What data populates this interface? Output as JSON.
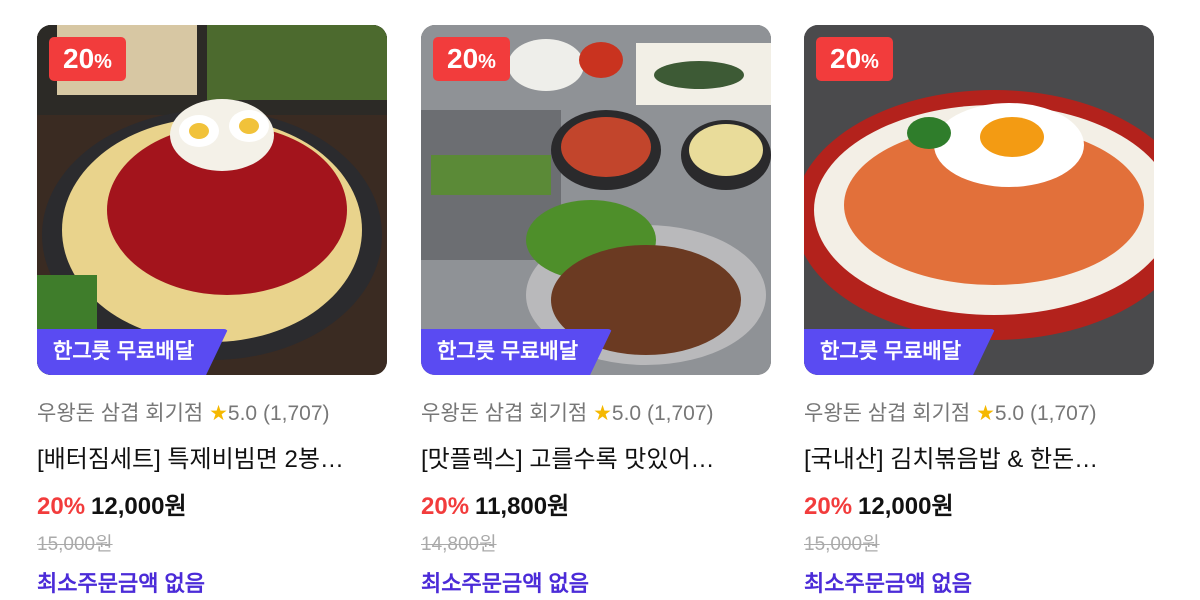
{
  "products": [
    {
      "discount_badge": "20",
      "discount_badge_unit": "%",
      "delivery_tag": "한그릇 무료배달",
      "store": "우왕돈 삼겹 회기점",
      "star": "★",
      "rating": "5.0",
      "reviews": "(1,707)",
      "name": "[배터짐세트] 특제비빔면 2봉…",
      "discount": "20%",
      "price": "12,000원",
      "original_price": "15,000원",
      "min_order": "최소주문금액 없음",
      "image_icon": "bibim-noodles-image"
    },
    {
      "discount_badge": "20",
      "discount_badge_unit": "%",
      "delivery_tag": "한그릇 무료배달",
      "store": "우왕돈 삼겹 회기점",
      "star": "★",
      "rating": "5.0",
      "reviews": "(1,707)",
      "name": "[맛플렉스] 고를수록 맛있어…",
      "discount": "20%",
      "price": "11,800원",
      "original_price": "14,800원",
      "min_order": "최소주문금액 없음",
      "image_icon": "pork-belly-set-image"
    },
    {
      "discount_badge": "20",
      "discount_badge_unit": "%",
      "delivery_tag": "한그릇 무료배달",
      "store": "우왕돈 삼겹 회기점",
      "star": "★",
      "rating": "5.0",
      "reviews": "(1,707)",
      "name": "[국내산] 김치볶음밥 & 한돈…",
      "discount": "20%",
      "price": "12,000원",
      "original_price": "15,000원",
      "min_order": "최소주문금액 없음",
      "image_icon": "kimchi-fried-rice-image"
    }
  ],
  "colors": {
    "discount_red": "#f23c3c",
    "delivery_purple": "#5a4bf2",
    "min_order_purple": "#4b2bd8",
    "star_yellow": "#f5b800"
  }
}
